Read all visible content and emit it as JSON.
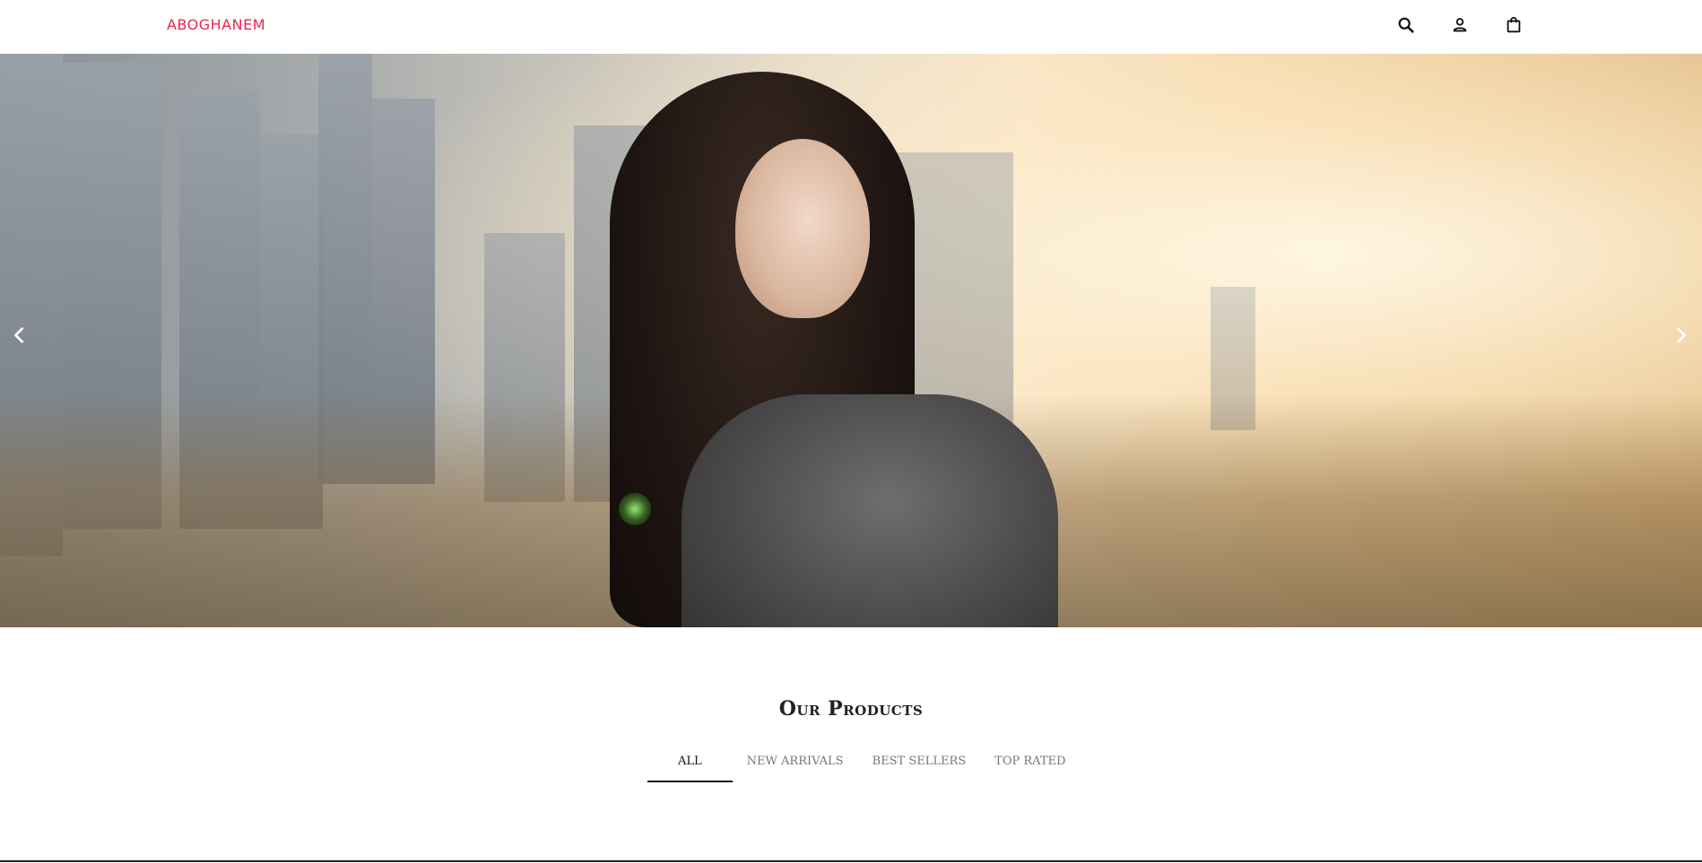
{
  "header": {
    "brand": "ABOGHANEM",
    "icons": [
      "search-icon",
      "account-icon",
      "shopping-bag-icon"
    ]
  },
  "hero": {
    "prev_icon": "chevron-left-icon",
    "next_icon": "chevron-right-icon"
  },
  "products": {
    "title": "Our Products",
    "tabs": [
      {
        "label": "ALL",
        "active": true
      },
      {
        "label": "NEW ARRIVALS",
        "active": false
      },
      {
        "label": "BEST SELLERS",
        "active": false
      },
      {
        "label": "TOP RATED",
        "active": false
      }
    ]
  },
  "colors": {
    "brand": "#e8264f",
    "text": "#111111",
    "muted": "#777777"
  }
}
